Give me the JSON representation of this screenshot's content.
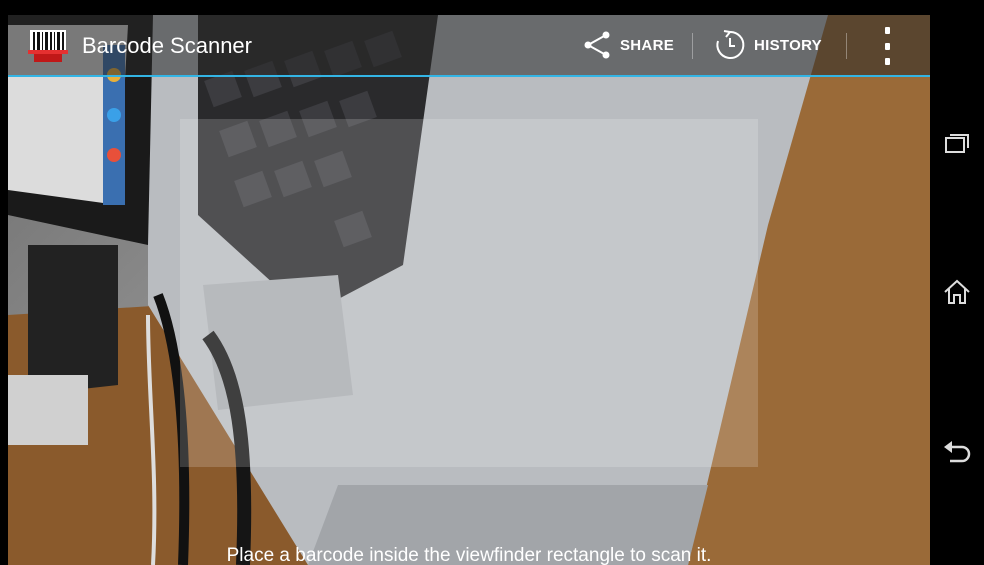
{
  "app": {
    "title": "Barcode Scanner",
    "icon": "barcode-scanner-icon"
  },
  "actionbar": {
    "share_label": "SHARE",
    "share_icon": "share-icon",
    "history_label": "HISTORY",
    "history_icon": "history-icon",
    "overflow_icon": "overflow-menu-icon",
    "accent_color": "#33b5e5"
  },
  "viewfinder": {
    "status_text": "Place a barcode inside the viewfinder rectangle to scan it."
  },
  "navbar": {
    "recent_icon": "recent-apps-icon",
    "home_icon": "home-icon",
    "back_icon": "back-icon"
  }
}
